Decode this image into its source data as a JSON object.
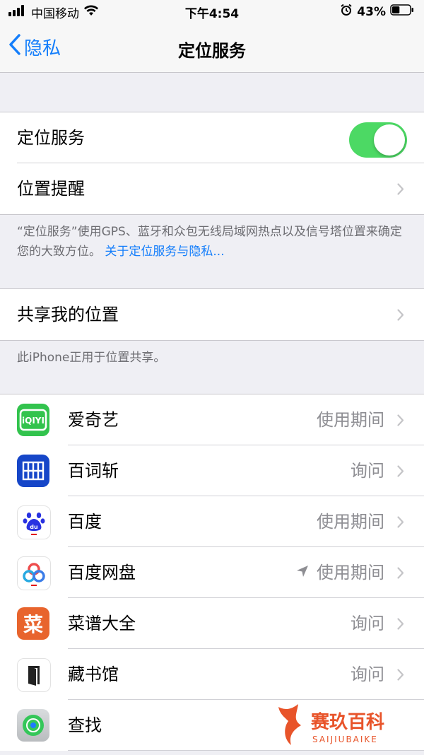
{
  "status_bar": {
    "carrier": "中国移动",
    "time": "下午4:54",
    "battery": "43%",
    "battery_level": 0.43
  },
  "nav": {
    "back_label": "隐私",
    "title": "定位服务"
  },
  "group_location": {
    "location_services_label": "定位服务",
    "location_services_on": true,
    "location_alerts_label": "位置提醒"
  },
  "footer1": {
    "text": "“定位服务”使用GPS、蓝牙和众包无线局域网热点以及信号塔位置来确定您的大致方位。",
    "link": "关于定位服务与隐私..."
  },
  "group_share": {
    "label": "共享我的位置"
  },
  "footer2": {
    "text": "此iPhone正用于位置共享。"
  },
  "apps": [
    {
      "name": "爱奇艺",
      "value": "使用期间",
      "icon": "iqiyi-icon"
    },
    {
      "name": "百词斩",
      "value": "询问",
      "icon": "baicizhan-icon"
    },
    {
      "name": "百度",
      "value": "使用期间",
      "icon": "baidu-icon"
    },
    {
      "name": "百度网盘",
      "value": "使用期间",
      "icon": "baidu-netdisk-icon",
      "recent_use": true
    },
    {
      "name": "菜谱大全",
      "value": "询问",
      "icon": "recipe-icon",
      "icon_text": "菜"
    },
    {
      "name": "藏书馆",
      "value": "询问",
      "icon": "library-icon"
    },
    {
      "name": "查找",
      "value": "",
      "icon": "find-my-icon"
    }
  ],
  "watermark": {
    "line1": "赛玖百科",
    "line2": "SAIJIUBAIKE"
  },
  "colors": {
    "accent": "#147efb",
    "toggle_on": "#4cd964",
    "secondary_text": "#8e8e93",
    "background": "#efeff4"
  }
}
